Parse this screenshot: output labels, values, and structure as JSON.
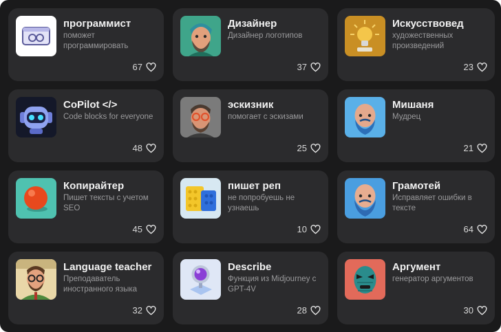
{
  "cards": [
    {
      "title": "программист",
      "desc": "поможет программировать",
      "likes": "67",
      "icon": "code-window-icon"
    },
    {
      "title": "Дизайнер",
      "desc": "Дизайнер логотипов",
      "likes": "37",
      "icon": "designer-avatar"
    },
    {
      "title": "Искусствовед",
      "desc": "художественных произведений",
      "likes": "23",
      "icon": "lightbulb-icon"
    },
    {
      "title": "CoPilot </>",
      "desc": "Code blocks for everyone",
      "likes": "48",
      "icon": "robot-icon"
    },
    {
      "title": "эскизник",
      "desc": "помогает с эскизами",
      "likes": "25",
      "icon": "sketcher-avatar"
    },
    {
      "title": "Мишаня",
      "desc": "Мудрец",
      "likes": "21",
      "icon": "sage-avatar"
    },
    {
      "title": "Копирайтер",
      "desc": "Пишет тексты с учетом SEO",
      "likes": "45",
      "icon": "orange-ball-icon"
    },
    {
      "title": "пишет реп",
      "desc": "не попробуешь не узнаешь",
      "likes": "10",
      "icon": "blocks-icon"
    },
    {
      "title": "Грамотей",
      "desc": "Исправляет ошибки в тексте",
      "likes": "64",
      "icon": "grammar-avatar"
    },
    {
      "title": "Language teacher",
      "desc": "Преподаватель иностранного языка",
      "likes": "32",
      "icon": "teacher-avatar"
    },
    {
      "title": "Describe",
      "desc": "Функция из Midjourney с GPT-4V",
      "likes": "28",
      "icon": "lens-icon"
    },
    {
      "title": "Аргумент",
      "desc": "генератор аргументов",
      "likes": "30",
      "icon": "mask-icon"
    }
  ],
  "colors": {
    "background": "#1a1a1b",
    "card": "#2b2b2d",
    "title": "#f2f2f2",
    "description": "#9a9a9c"
  }
}
